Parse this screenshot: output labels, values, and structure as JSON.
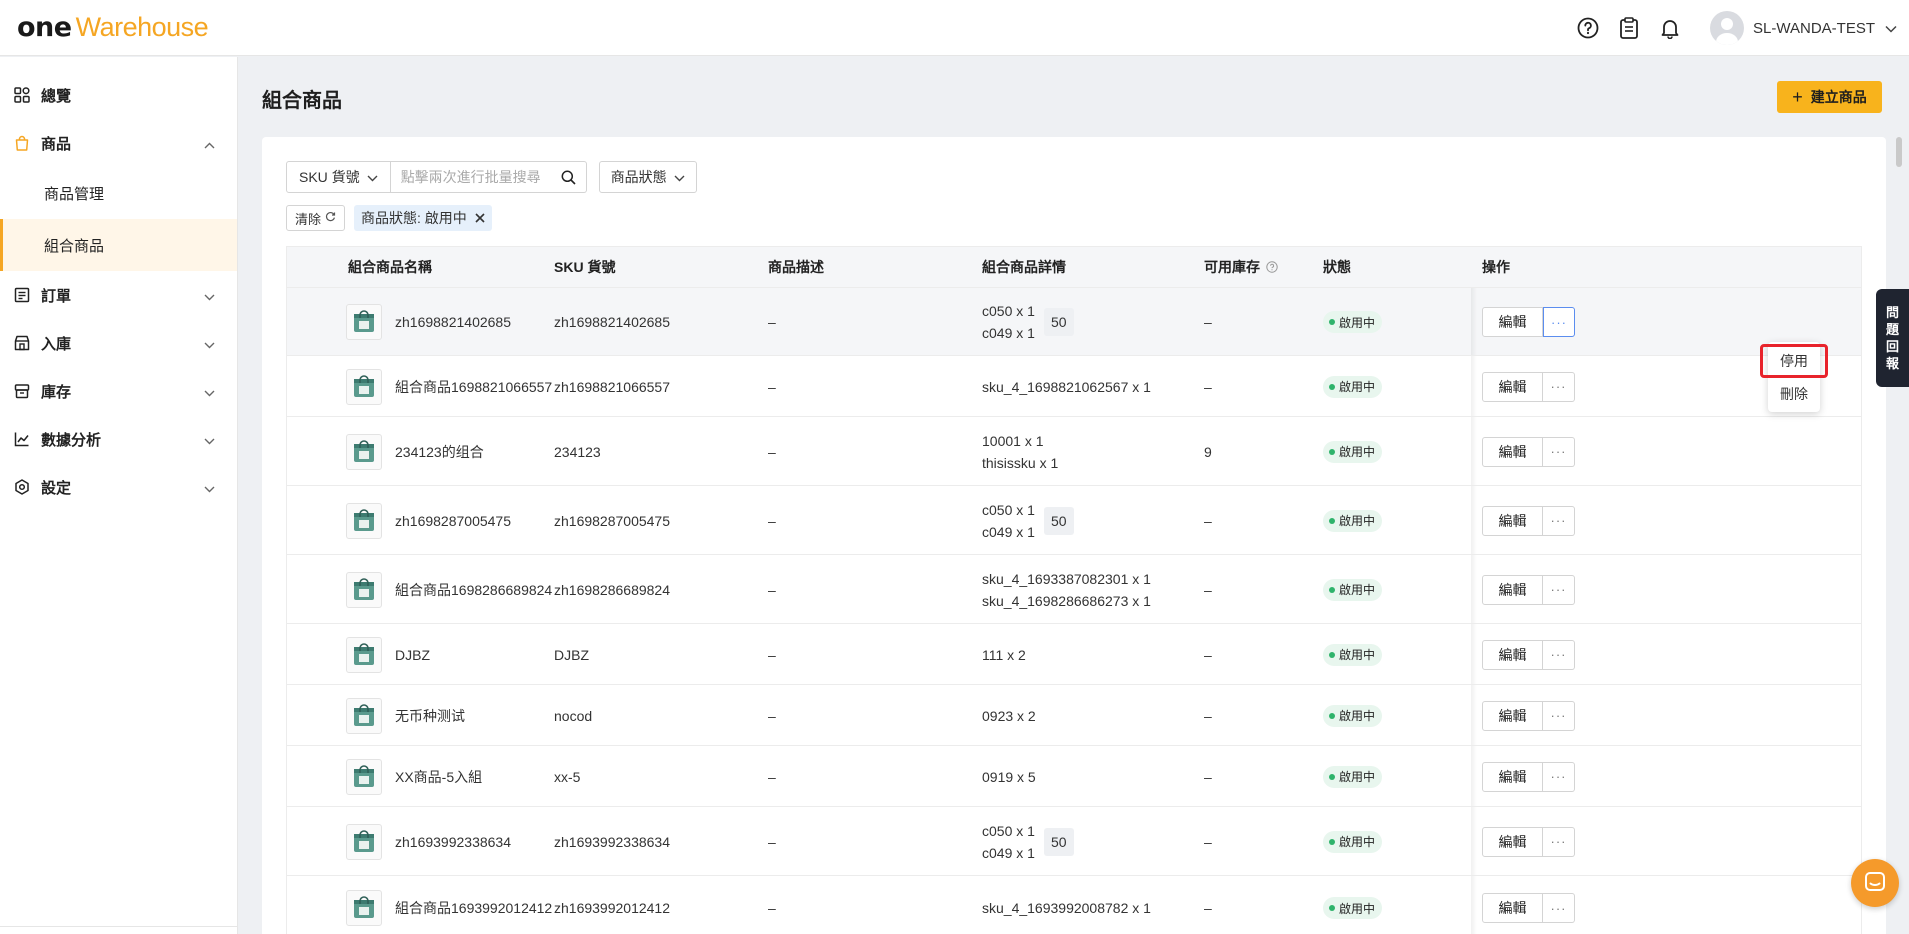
{
  "header": {
    "logo_one": "one",
    "logo_warehouse": "Warehouse",
    "user_name": "SL-WANDA-TEST"
  },
  "sidebar": {
    "items": [
      {
        "label": "總覽",
        "icon": "dashboard-icon"
      },
      {
        "label": "商品",
        "icon": "bag-icon",
        "expanded": true
      },
      {
        "label": "商品管理",
        "sub": true
      },
      {
        "label": "組合商品",
        "sub": true,
        "active": true
      },
      {
        "label": "訂單",
        "icon": "order-icon"
      },
      {
        "label": "入庫",
        "icon": "inbound-icon"
      },
      {
        "label": "庫存",
        "icon": "inventory-icon"
      },
      {
        "label": "數據分析",
        "icon": "analytics-icon"
      },
      {
        "label": "設定",
        "icon": "settings-icon"
      }
    ]
  },
  "main": {
    "title": "組合商品",
    "create_label": "建立商品",
    "search_type": "SKU 貨號",
    "search_placeholder": "點擊兩次進行批量搜尋",
    "status_filter": "商品狀態",
    "clear_label": "清除",
    "active_tag": "商品狀態: 啟用中"
  },
  "table": {
    "columns": [
      "組合商品名稱",
      "SKU 貨號",
      "商品描述",
      "組合商品詳情",
      "可用庫存",
      "狀態",
      "操作"
    ],
    "rows": [
      {
        "name": "zh1698821402685",
        "sku": "zh1698821402685",
        "desc": "–",
        "details": [
          "c050 x 1",
          "c049 x 1"
        ],
        "qty": "50",
        "stock": "–",
        "status": "啟用中"
      },
      {
        "name": "組合商品1698821066557",
        "sku": "zh1698821066557",
        "desc": "–",
        "details": [
          "sku_4_1698821062567 x 1"
        ],
        "qty": "",
        "stock": "–",
        "status": "啟用中"
      },
      {
        "name": "234123的组合",
        "sku": "234123",
        "desc": "–",
        "details": [
          "10001 x 1",
          "thisissku x 1"
        ],
        "qty": "",
        "stock": "9",
        "status": "啟用中"
      },
      {
        "name": "zh1698287005475",
        "sku": "zh1698287005475",
        "desc": "–",
        "details": [
          "c050 x 1",
          "c049 x 1"
        ],
        "qty": "50",
        "stock": "–",
        "status": "啟用中"
      },
      {
        "name": "組合商品1698286689824",
        "sku": "zh1698286689824",
        "desc": "–",
        "details": [
          "sku_4_1693387082301 x 1",
          "sku_4_1698286686273 x 1"
        ],
        "qty": "",
        "stock": "–",
        "status": "啟用中"
      },
      {
        "name": "DJBZ",
        "sku": "DJBZ",
        "desc": "–",
        "details": [
          "111 x 2"
        ],
        "qty": "",
        "stock": "–",
        "status": "啟用中"
      },
      {
        "name": "无币种测试",
        "sku": "nocod",
        "desc": "–",
        "details": [
          "0923 x 2"
        ],
        "qty": "",
        "stock": "–",
        "status": "啟用中"
      },
      {
        "name": "XX商品-5入組",
        "sku": "xx-5",
        "desc": "–",
        "details": [
          "0919 x 5"
        ],
        "qty": "",
        "stock": "–",
        "status": "啟用中"
      },
      {
        "name": "zh1693992338634",
        "sku": "zh1693992338634",
        "desc": "–",
        "details": [
          "c050 x 1",
          "c049 x 1"
        ],
        "qty": "50",
        "stock": "–",
        "status": "啟用中"
      },
      {
        "name": "組合商品1693992012412",
        "sku": "zh1693992012412",
        "desc": "–",
        "details": [
          "sku_4_1693992008782 x 1"
        ],
        "qty": "",
        "stock": "–",
        "status": "啟用中"
      }
    ],
    "edit_label": "編輯",
    "more_label": "···"
  },
  "dropdown": {
    "items": [
      "停用",
      "刪除"
    ]
  },
  "feedback_label": [
    "問",
    "題",
    "回",
    "報"
  ],
  "colors": {
    "accent": "#f8b31c",
    "brand_orange": "#f5a623",
    "status_green": "#2fb36b",
    "highlight_red": "#e8232b"
  }
}
